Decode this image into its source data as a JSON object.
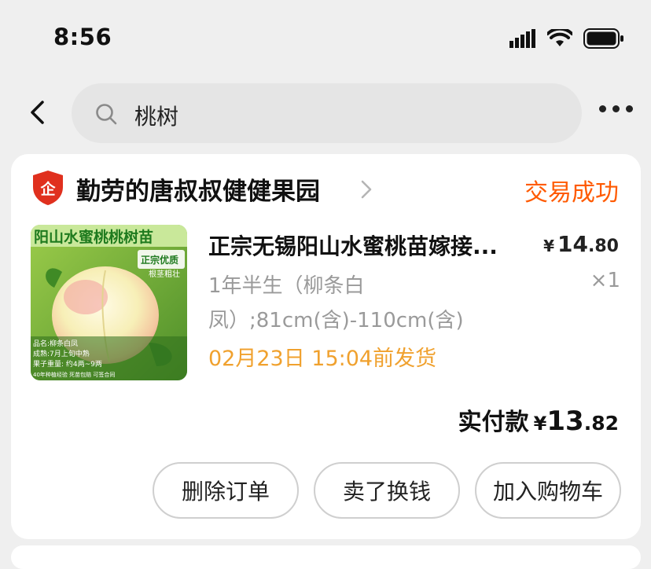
{
  "status_bar": {
    "time": "8:56"
  },
  "search": {
    "query": "桃树"
  },
  "order": {
    "shop_name": "勤劳的唐叔叔健健果园",
    "shop_badge": "企",
    "status": "交易成功",
    "product": {
      "title": "正宗无锡阳山水蜜桃苗嫁接...",
      "price_symbol": "¥",
      "price_int": "14",
      "price_dec": ".80",
      "spec_line1": "1年半生（柳条白",
      "spec_line2": "凤）;81cm(含)-110cm(含)",
      "quantity": "×1",
      "ship_time": "02月23日 15:04前发货",
      "image": {
        "banner": "阳山水蜜桃桃树苗",
        "tag_main": "正宗优质",
        "tag_sub": "根茎粗壮",
        "info1": "品名:柳条白凤",
        "info2": "成熟:7月上旬中熟",
        "info3": "果子重量: 约4两~9两",
        "info4": "40年种植经验 死苗包赔 可签合同"
      }
    },
    "paid_label": "实付款",
    "paid_symbol": "¥",
    "paid_int": "13",
    "paid_dec": ".82",
    "buttons": {
      "delete": "删除订单",
      "resell": "卖了换钱",
      "add_cart": "加入购物车"
    }
  },
  "colors": {
    "accent": "#ff5a00",
    "ship": "#f0a12e",
    "badge": "#e0301e"
  }
}
